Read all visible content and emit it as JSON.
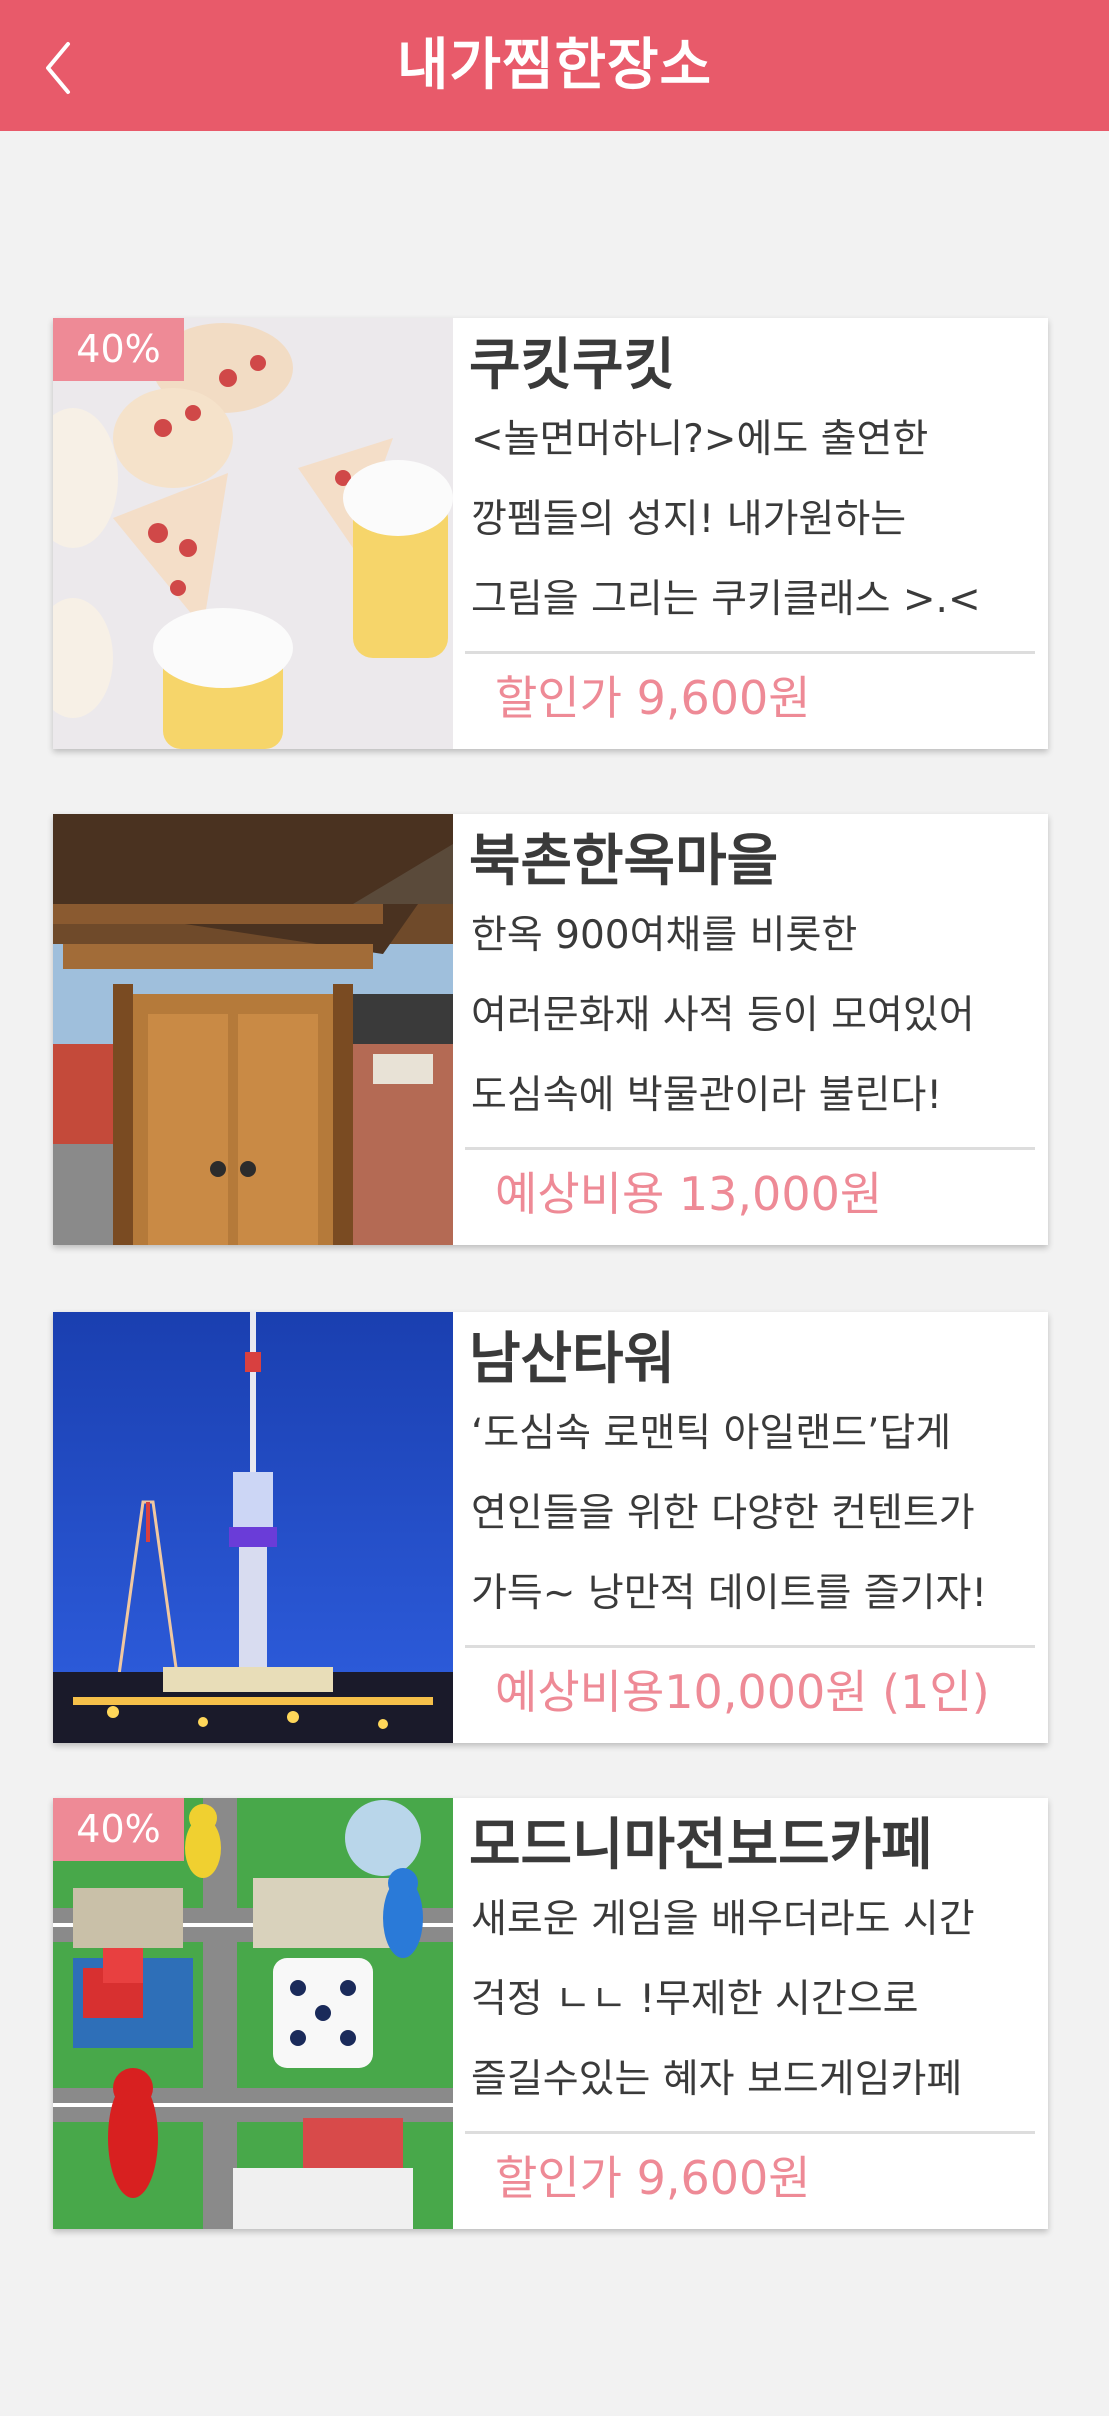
{
  "header": {
    "title": "내가찜한장소",
    "back_icon": "chevron-left-icon"
  },
  "colors": {
    "header_bg": "#e85a6a",
    "price": "#ee8a96",
    "badge_bg": "#ee8a96",
    "page_bg": "#f2f2f2"
  },
  "cards": [
    {
      "badge": "40%",
      "title": "쿠킷쿠킷",
      "description": "<놀면머하니?>에도 출연한\n깡펨들의 성지!  내가원하는\n그림을 그리는 쿠키클래스 >.<",
      "price": "할인가 9,600원",
      "image": "cookies-photo"
    },
    {
      "title": "북촌한옥마을",
      "description": "한옥 900여채를 비롯한\n여러문화재 사적 등이 모여있어\n도심속에 박물관이라 불린다!",
      "price": "예상비용 13,000원",
      "image": "hanok-door-photo"
    },
    {
      "title": "남산타워",
      "description": "‘도심속 로맨틱 아일랜드’답게\n연인들을 위한 다양한 컨텐트가\n가득~ 낭만적 데이트를 즐기자!",
      "price": "예상비용10,000원 (1인)",
      "image": "namsan-tower-photo"
    },
    {
      "badge": "40%",
      "title": "모드니마전보드카페",
      "description": "새로운 게임을 배우더라도 시간\n걱정 ㄴㄴ !무제한 시간으로\n즐길수있는 혜자 보드게임카페",
      "price": "할인가 9,600원",
      "image": "board-game-photo"
    }
  ]
}
